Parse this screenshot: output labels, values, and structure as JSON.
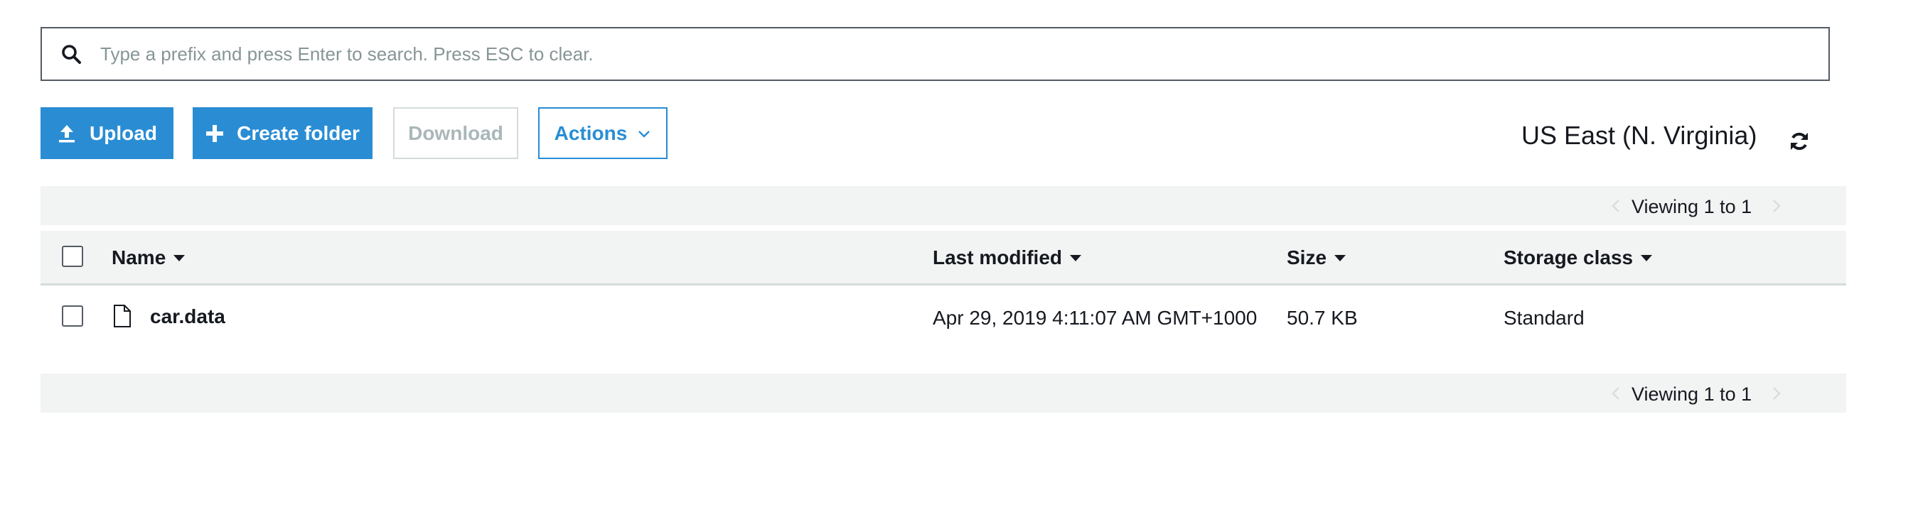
{
  "search": {
    "placeholder": "Type a prefix and press Enter to search. Press ESC to clear.",
    "value": ""
  },
  "toolbar": {
    "upload_label": "Upload",
    "create_folder_label": "Create folder",
    "download_label": "Download",
    "actions_label": "Actions"
  },
  "region": "US East (N. Virginia)",
  "pagination": {
    "top_text": "Viewing 1 to 1",
    "bottom_text": "Viewing 1 to 1"
  },
  "table": {
    "columns": {
      "name": "Name",
      "last_modified": "Last modified",
      "size": "Size",
      "storage_class": "Storage class"
    },
    "rows": [
      {
        "name": "car.data",
        "last_modified": "Apr 29, 2019 4:11:07 AM GMT+1000",
        "size": "50.7 KB",
        "storage_class": "Standard"
      }
    ]
  },
  "colors": {
    "primary": "#2a8dd4",
    "header_bg": "#f2f3f3",
    "disabled_text": "#aab7b8",
    "text": "#16191f"
  },
  "icons": {
    "search": "search-icon",
    "upload": "upload-icon",
    "plus": "plus-icon",
    "chevron": "chevron-down-icon",
    "refresh": "refresh-icon",
    "file": "file-icon",
    "sort": "caret-down-icon",
    "prev": "chevron-left-icon",
    "next": "chevron-right-icon"
  }
}
